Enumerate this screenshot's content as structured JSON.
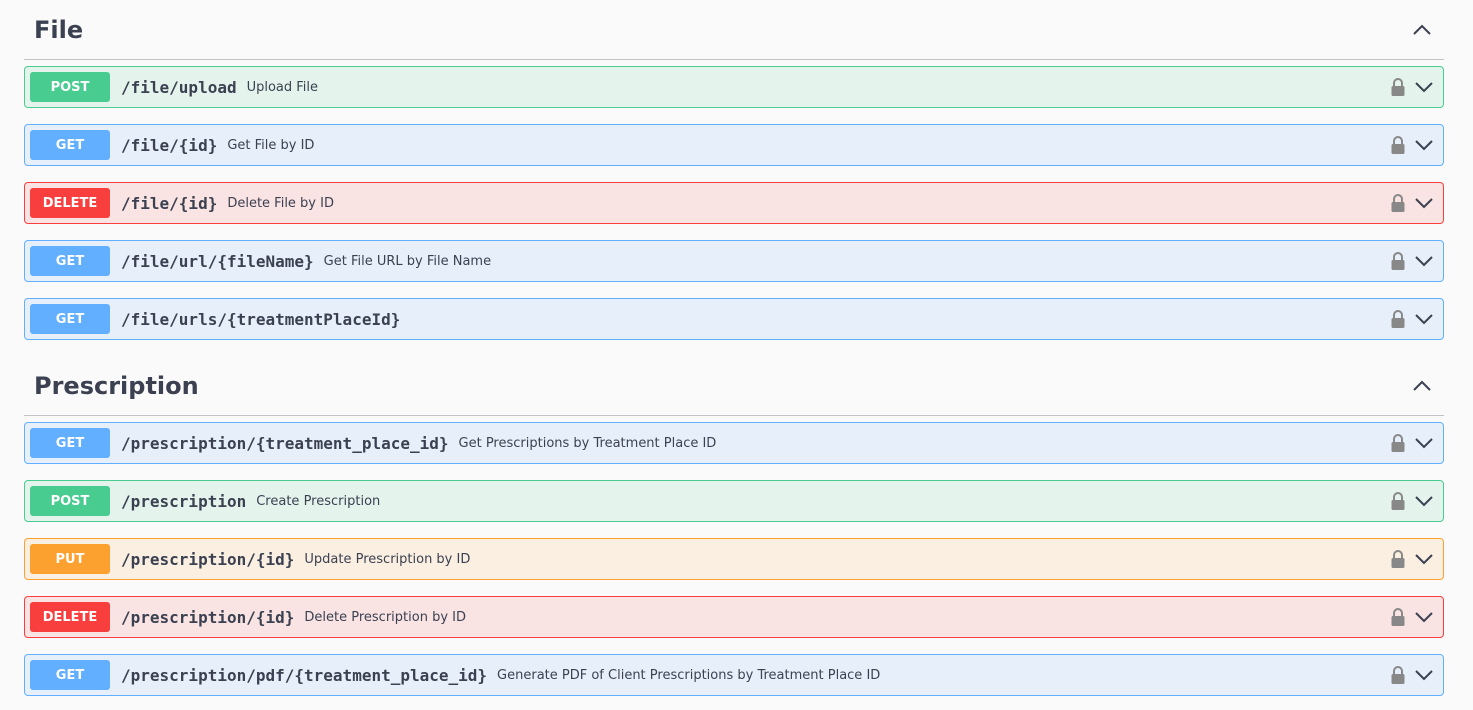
{
  "sections": [
    {
      "title": "File",
      "collapse_icon": "chevron-up-icon",
      "operations": [
        {
          "method": "POST",
          "class": "post",
          "path": "/file/upload",
          "summary": "Upload File"
        },
        {
          "method": "GET",
          "class": "get",
          "path": "/file/{id}",
          "summary": "Get File by ID"
        },
        {
          "method": "DELETE",
          "class": "delete",
          "path": "/file/{id}",
          "summary": "Delete File by ID"
        },
        {
          "method": "GET",
          "class": "get",
          "path": "/file/url/{fileName}",
          "summary": "Get File URL by File Name"
        },
        {
          "method": "GET",
          "class": "get",
          "path": "/file/urls/{treatmentPlaceId}",
          "summary": ""
        }
      ]
    },
    {
      "title": "Prescription",
      "collapse_icon": "chevron-up-icon",
      "operations": [
        {
          "method": "GET",
          "class": "get",
          "path": "/prescription/{treatment_place_id}",
          "summary": "Get Prescriptions by Treatment Place ID"
        },
        {
          "method": "POST",
          "class": "post",
          "path": "/prescription",
          "summary": "Create Prescription"
        },
        {
          "method": "PUT",
          "class": "put",
          "path": "/prescription/{id}",
          "summary": "Update Prescription by ID"
        },
        {
          "method": "DELETE",
          "class": "delete",
          "path": "/prescription/{id}",
          "summary": "Delete Prescription by ID"
        },
        {
          "method": "GET",
          "class": "get",
          "path": "/prescription/pdf/{treatment_place_id}",
          "summary": "Generate PDF of Client Prescriptions by Treatment Place ID"
        }
      ]
    }
  ],
  "icons": {
    "lock": "lock-icon",
    "expand": "chevron-down-icon",
    "collapse": "chevron-up-icon"
  },
  "colors": {
    "post": "#49cc90",
    "get": "#61affe",
    "delete": "#f93e3e",
    "put": "#fca130",
    "text": "#3b4151"
  }
}
